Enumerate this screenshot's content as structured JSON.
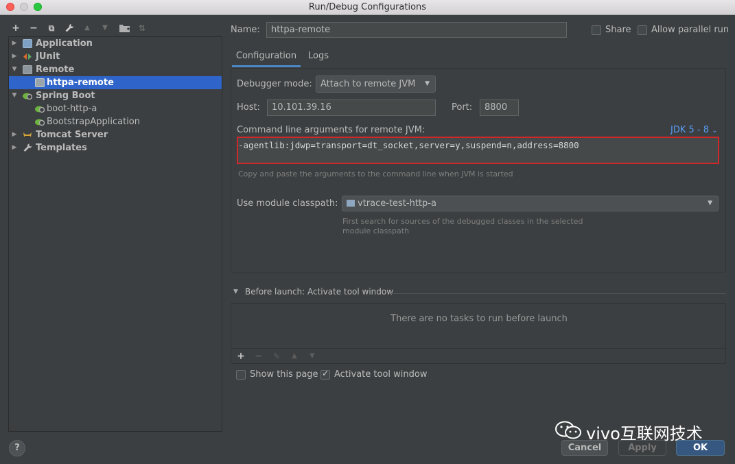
{
  "window": {
    "title": "Run/Debug Configurations"
  },
  "toolbar": {
    "add": "+",
    "remove": "−",
    "copy": "⧉",
    "settings": "🔧",
    "move_up": "▲",
    "move_down": "▼",
    "folder": "📁",
    "sort": "⇅"
  },
  "tree": {
    "items": [
      {
        "label": "Application",
        "icon": "application-icon"
      },
      {
        "label": "JUnit",
        "icon": "junit-icon"
      },
      {
        "label": "Remote",
        "icon": "remote-icon"
      },
      {
        "label": "httpa-remote",
        "icon": "remote-config-icon"
      },
      {
        "label": "Spring Boot",
        "icon": "spring-boot-icon"
      },
      {
        "label": "boot-http-a",
        "icon": "spring-boot-config-icon"
      },
      {
        "label": "BootstrapApplication",
        "icon": "spring-boot-config-icon"
      },
      {
        "label": "Tomcat Server",
        "icon": "tomcat-icon"
      },
      {
        "label": "Templates",
        "icon": "wrench-icon"
      }
    ]
  },
  "help": {
    "label": "?"
  },
  "config": {
    "name_label": "Name:",
    "name_value": "httpa-remote",
    "share_label": "Share",
    "parallel_label": "Allow parallel run",
    "tabs": [
      {
        "label": "Configuration"
      },
      {
        "label": "Logs"
      }
    ],
    "debugger_mode_label": "Debugger mode:",
    "debugger_mode_value": "Attach to remote JVM",
    "host_label": "Host:",
    "host_value": "10.101.39.16",
    "port_label": "Port:",
    "port_value": "8800",
    "args_label": "Command line arguments for remote JVM:",
    "jdk_link": "JDK 5 - 8",
    "args_value": "-agentlib:jdwp=transport=dt_socket,server=y,suspend=n,address=8800",
    "args_hint": "Copy and paste the arguments to the command line when JVM is started",
    "module_label": "Use module classpath:",
    "module_value": "vtrace-test-http-a",
    "module_hint_1": "First search for sources of the debugged classes in the selected",
    "module_hint_2": "module classpath"
  },
  "before_launch": {
    "title": "Before launch: Activate tool window",
    "empty": "There are no tasks to run before launch",
    "add": "+",
    "remove": "−",
    "edit": "✎",
    "up": "▲",
    "down": "▼",
    "show_page_label": "Show this page",
    "activate_label": "Activate tool window"
  },
  "buttons": {
    "cancel": "Cancel",
    "apply": "Apply",
    "ok": "OK"
  },
  "watermark": {
    "text": "vivo互联网技术"
  },
  "colors": {
    "selection": "#2f65ca",
    "highlight_border": "#d0282a",
    "link": "#589df6",
    "ok_button": "#365880"
  }
}
